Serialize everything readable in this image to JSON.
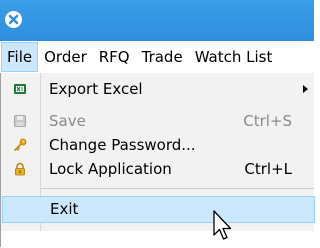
{
  "menubar": {
    "items": [
      {
        "label": "File"
      },
      {
        "label": "Order"
      },
      {
        "label": "RFQ"
      },
      {
        "label": "Trade"
      },
      {
        "label": "Watch List"
      }
    ],
    "active_index": 0
  },
  "file_menu": {
    "items": [
      {
        "label": "Export Excel",
        "icon": "excel-icon",
        "shortcut": "",
        "submenu": true,
        "enabled": true
      },
      {
        "label": "Save",
        "icon": "save-icon",
        "shortcut": "Ctrl+S",
        "submenu": false,
        "enabled": false
      },
      {
        "label": "Change Password...",
        "icon": "key-icon",
        "shortcut": "",
        "submenu": false,
        "enabled": true
      },
      {
        "label": "Lock Application",
        "icon": "lock-icon",
        "shortcut": "Ctrl+L",
        "submenu": false,
        "enabled": true
      },
      {
        "label": "Exit",
        "icon": "",
        "shortcut": "",
        "submenu": false,
        "enabled": true,
        "highlighted": true
      }
    ]
  },
  "colors": {
    "titlebar": "#2f8fde",
    "highlight_bg": "#cce8ff",
    "highlight_border": "#99d1ff",
    "menu_bg": "#f2f2f2",
    "disabled_text": "#8a8a8a"
  }
}
